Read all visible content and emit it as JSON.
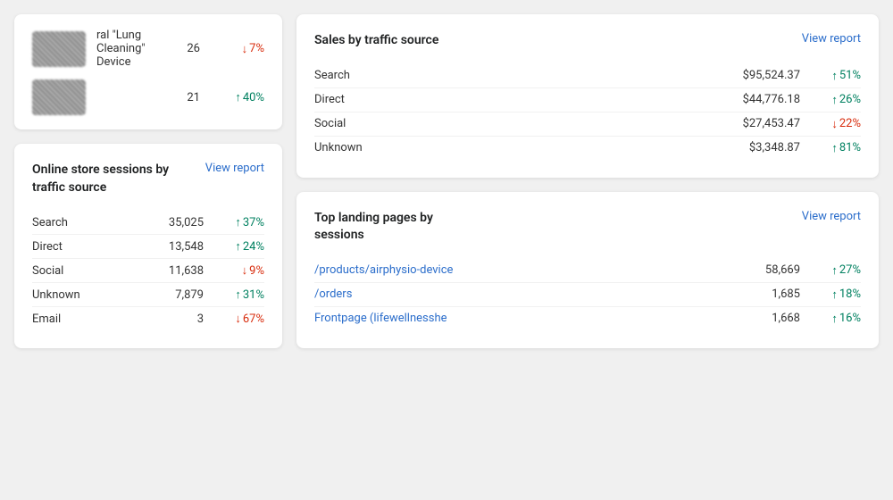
{
  "topProducts": {
    "items": [
      {
        "count": "26",
        "change": "7%",
        "direction": "down",
        "label": "ral \"Lung Cleaning\" Device"
      },
      {
        "count": "21",
        "change": "40%",
        "direction": "up",
        "label": ""
      }
    ]
  },
  "sessionsByTraffic": {
    "title": "Online store sessions by traffic source",
    "viewReportLabel": "View report",
    "rows": [
      {
        "label": "Search",
        "value": "35,025",
        "change": "37%",
        "direction": "up"
      },
      {
        "label": "Direct",
        "value": "13,548",
        "change": "24%",
        "direction": "up"
      },
      {
        "label": "Social",
        "value": "11,638",
        "change": "9%",
        "direction": "down"
      },
      {
        "label": "Unknown",
        "value": "7,879",
        "change": "31%",
        "direction": "up"
      },
      {
        "label": "Email",
        "value": "3",
        "change": "67%",
        "direction": "down"
      }
    ]
  },
  "salesByTraffic": {
    "title": "Sales by traffic source",
    "viewReportLabel": "View report",
    "rows": [
      {
        "label": "Search",
        "value": "$95,524.37",
        "change": "51%",
        "direction": "up"
      },
      {
        "label": "Direct",
        "value": "$44,776.18",
        "change": "26%",
        "direction": "up"
      },
      {
        "label": "Social",
        "value": "$27,453.47",
        "change": "22%",
        "direction": "down"
      },
      {
        "label": "Unknown",
        "value": "$3,348.87",
        "change": "81%",
        "direction": "up"
      }
    ]
  },
  "topLandingPages": {
    "title": "Top landing pages by sessions",
    "viewReportLabel": "View report",
    "rows": [
      {
        "label": "/products/airphysio-device",
        "value": "58,669",
        "change": "27%",
        "direction": "up"
      },
      {
        "label": "/orders",
        "value": "1,685",
        "change": "18%",
        "direction": "up"
      },
      {
        "label": "Frontpage (lifewellnesshe",
        "value": "1,668",
        "change": "16%",
        "direction": "up"
      }
    ]
  }
}
